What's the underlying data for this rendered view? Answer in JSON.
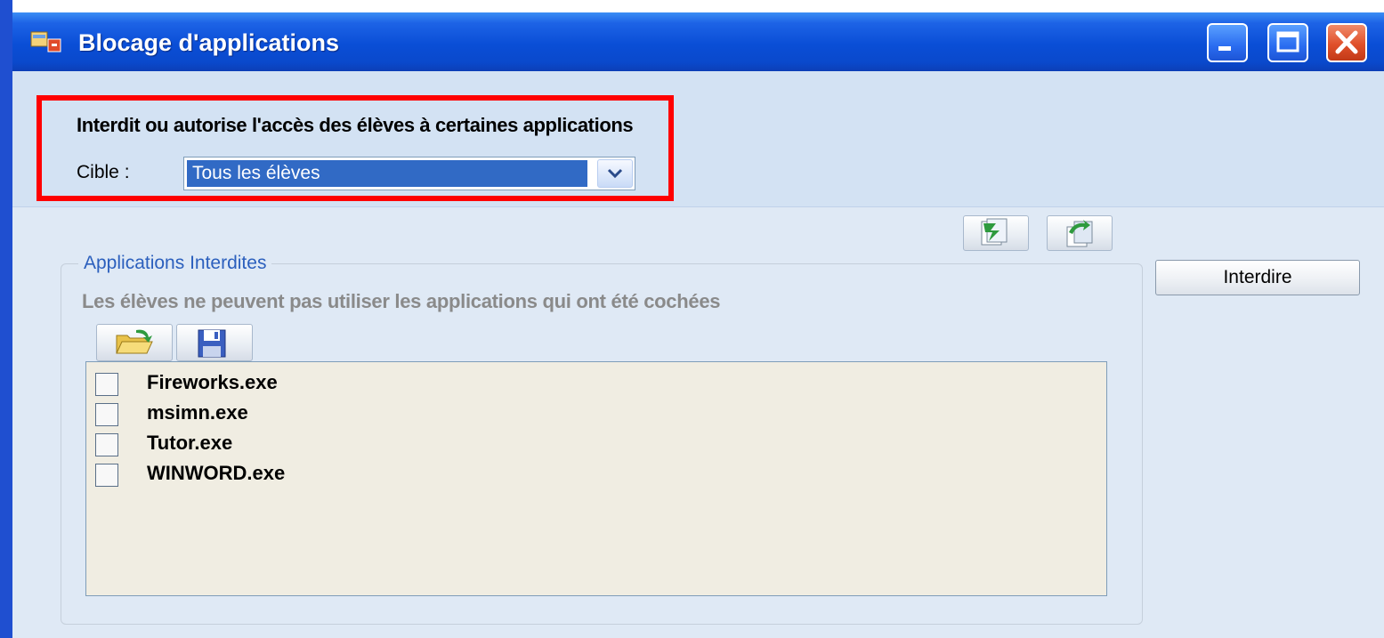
{
  "window": {
    "title": "Blocage d'applications",
    "controls": {
      "minimize": "minimize-icon",
      "maximize": "maximize-icon",
      "close": "close-icon"
    }
  },
  "header": {
    "subtitle": "Interdit ou autorise l'accès des élèves à certaines applications",
    "target_label": "Cible :",
    "target_value": "Tous les élèves"
  },
  "toolbar": {
    "import_icon": "import-icon",
    "export_icon": "export-icon"
  },
  "actions": {
    "forbid_label": "Interdire"
  },
  "forbidden_group": {
    "legend": "Applications Interdites",
    "description": "Les élèves ne peuvent pas utiliser les applications qui ont été cochées",
    "open_icon": "folder-open-icon",
    "save_icon": "save-icon",
    "apps": [
      {
        "name": "Fireworks.exe",
        "checked": false
      },
      {
        "name": "msimn.exe",
        "checked": false
      },
      {
        "name": "Tutor.exe",
        "checked": false
      },
      {
        "name": "WINWORD.exe",
        "checked": false
      }
    ]
  },
  "colors": {
    "titlebar": "#0a4ed6",
    "highlight_border": "#ff0000",
    "selection": "#316ac5",
    "legend_text": "#2b5fbd"
  }
}
